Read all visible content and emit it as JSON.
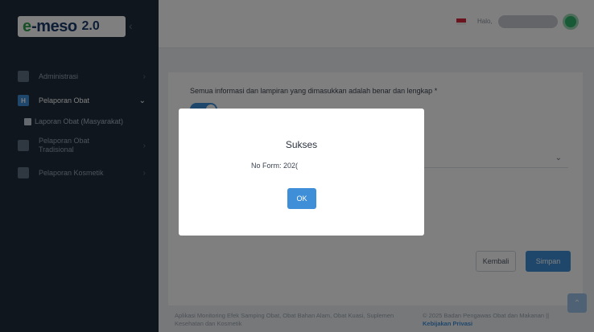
{
  "app": {
    "logo_prefix": "e",
    "logo_name": "-meso",
    "logo_version": "2.0"
  },
  "sidebar": {
    "items": [
      {
        "label": "Administrasi"
      },
      {
        "label": "Pelaporan Obat"
      },
      {
        "label": "Laporan Obat (Masyarakat)"
      },
      {
        "label": "Pelaporan Obat Tradisional"
      },
      {
        "label": "Pelaporan Kosmetik"
      }
    ],
    "active_letter": "H"
  },
  "header": {
    "greeting": "Halo,"
  },
  "form": {
    "statement": "Semua informasi dan lampiran yang dimasukkan adalah benar dan lengkap *",
    "back_label": "Kembali",
    "save_label": "Simpan"
  },
  "footer": {
    "left_text": "Aplikasi Monitoring Efek Samping Obat, Obat Bahan Alam, Obat Kuasi, Suplemen Kesehatan dan Kosmetik",
    "right_text": "© 2025 Badan Pengawas Obat dan Makanan ||",
    "privacy_link": "Kebijakan Privasi"
  },
  "modal": {
    "title": "Sukses",
    "message": "No Form: 202(",
    "ok_label": "OK"
  },
  "colors": {
    "sidebar_bg": "#1f2d3d",
    "accent": "#3f8fd8",
    "avatar": "#2fb46a",
    "flag": "#d6283b"
  }
}
